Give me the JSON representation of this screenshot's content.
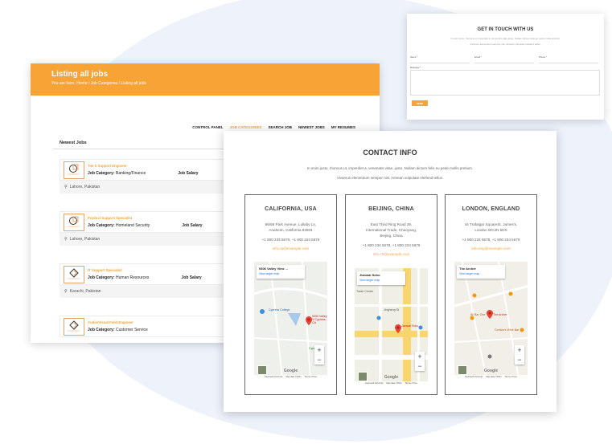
{
  "listing": {
    "title": "Listing all jobs",
    "crumb": "You are here:  Home / Job Categories / Listing all jobs",
    "nav": [
      "CONTROL PANEL",
      "JOB CATEGORIES",
      "SEARCH JOB",
      "NEWEST JOBS",
      "MY RESUMES"
    ],
    "nav_active": 1,
    "newest_label": "Newest Jobs",
    "category_label": "Job Category:",
    "salary_label": "Job Salary",
    "logo_word": "COMPANY",
    "jobs": [
      {
        "title": "Tier II Support Engineer",
        "category": "Banking/Finance",
        "location": "Lahore, Pakistan"
      },
      {
        "title": "Product Support Specialist",
        "category": "Homeland Security",
        "location": "Lahore, Pakistan"
      },
      {
        "title": "IT Support Specialist",
        "category": "Human Resources",
        "location": "Karachi, Pakistan"
      },
      {
        "title": "Audio/Visual Field Engineer",
        "category": "Customer Service",
        "location": ""
      }
    ]
  },
  "form": {
    "title": "GET IN TOUCH WITH US",
    "sub1": "In enim justo, rhoncus ut, imperdiet a, venenatis vitae justo. Nullam dictum felis eu pede mollis pretium.",
    "sub2": "Vivamus elementum semper nisi. Aenean vulputate eleifend tellus.",
    "fields": [
      "Name *",
      "Email *",
      "Phone *"
    ],
    "message_label": "Message *",
    "send": "SEND"
  },
  "contact": {
    "title": "CONTACT INFO",
    "sub1": "In enim justo, rhoncus ut, imperdiet a, venenatis vitae, justo. Nullam dictum felis eu pede mollis pretium.",
    "sub2": "Vivamus elementum semper nisi. Aenean vulputate eleifend tellus.",
    "cards": [
      {
        "city": "CALIFORNIA, USA",
        "addr1": "86/58 Park Avenue, Lullaby Ln,",
        "addr2": "Anaheim, California 92804",
        "addr3": "",
        "phone": "+1 800 234 5678, +1 800 234 5679",
        "email": "info.ca@example.com",
        "map_name": "9306 Valley View ...",
        "map_link": "View larger map",
        "map_labels": [
          "Cypress College",
          "9300 Valley V Cypress, CA",
          "Cypress C"
        ]
      },
      {
        "city": "BEIJING, CHINA",
        "addr1": "East Third Ring Road 39,",
        "addr2": "International Trade, Chaoyang,",
        "addr3": "Beijing, China",
        "phone": "+1 800 234 5678, +1 800 234 5679",
        "email": "info.ch@example.com",
        "map_name": "Jianwai Soho",
        "map_link": "View larger map",
        "map_labels": [
          "Jianwai Soho",
          "Trade Center",
          "Jingheng St"
        ]
      },
      {
        "city": "LONDON, ENGLAND",
        "addr1": "44 Trafalgar SquareSt. James's,",
        "addr2": "London WC2N 5DS",
        "addr3": "",
        "phone": "+1 800 234 5678, +1 800 234 5679",
        "email": "info.eng@example.com",
        "map_name": "The Archer",
        "map_link": "View larger map",
        "map_labels": [
          "The Archer",
          "All Bar One",
          "Gordon's Wine Bar"
        ]
      }
    ],
    "map_footer": [
      "Keyboard shortcuts",
      "Map data ©2021",
      "Terms of Use"
    ],
    "google": "Google"
  }
}
